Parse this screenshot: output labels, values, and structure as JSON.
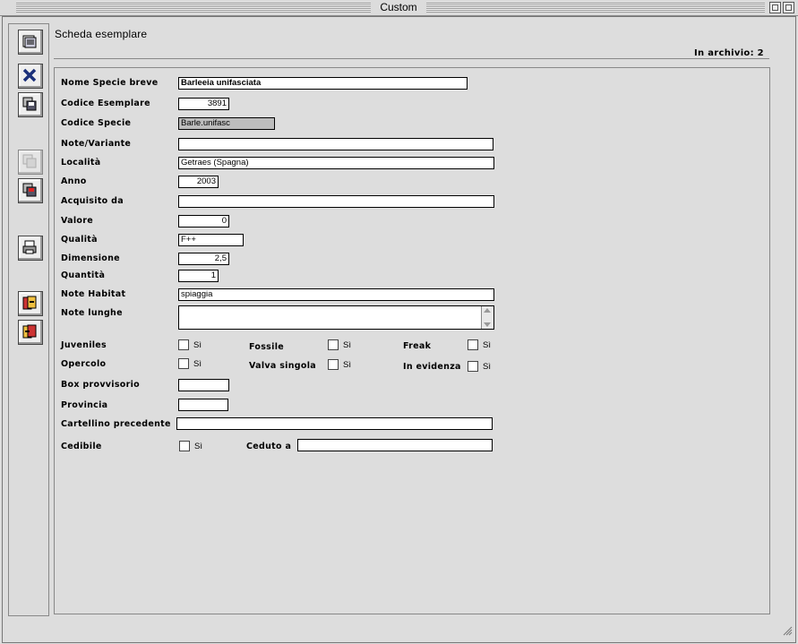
{
  "window": {
    "title": "Custom"
  },
  "header": {
    "sheet_title": "Scheda esemplare",
    "archive_count": "In archivio: 2"
  },
  "toolbar": {
    "buttons": [
      "form-view-icon",
      "delete-record-icon",
      "save-record-icon",
      "disabled-copy-icon",
      "save-copy-icon",
      "print-icon",
      "import-icon",
      "export-icon"
    ]
  },
  "form": {
    "nome_specie_breve": {
      "label": "Nome Specie breve",
      "value": "Barleeia unifasciata"
    },
    "codice_esemplare": {
      "label": "Codice Esemplare",
      "value": "3891"
    },
    "codice_specie": {
      "label": "Codice Specie",
      "value": "Barle.unifasc"
    },
    "note_variante": {
      "label": "Note/Variante",
      "value": ""
    },
    "localita": {
      "label": "Località",
      "value": "Getraes (Spagna)"
    },
    "anno": {
      "label": "Anno",
      "value": "2003"
    },
    "acquisito_da": {
      "label": "Acquisito da",
      "value": ""
    },
    "valore": {
      "label": "Valore",
      "value": "0"
    },
    "qualita": {
      "label": "Qualità",
      "value": "F++"
    },
    "dimensione": {
      "label": "Dimensione",
      "value": "2,5"
    },
    "quantita": {
      "label": "Quantità",
      "value": "1"
    },
    "note_habitat": {
      "label": "Note Habitat",
      "value": "spiaggia"
    },
    "note_lunghe": {
      "label": "Note lunghe",
      "value": ""
    },
    "juveniles": {
      "label": "Juveniles",
      "option": "Sì",
      "checked": false
    },
    "fossile": {
      "label": "Fossile",
      "option": "Sì",
      "checked": false
    },
    "freak": {
      "label": "Freak",
      "option": "Sì",
      "checked": false
    },
    "opercolo": {
      "label": "Opercolo",
      "option": "Sì",
      "checked": false
    },
    "valva_singola": {
      "label": "Valva singola",
      "option": "Sì",
      "checked": false
    },
    "in_evidenza": {
      "label": "In evidenza",
      "option": "Sì",
      "checked": false
    },
    "box_provvisorio": {
      "label": "Box provvisorio",
      "value": ""
    },
    "provincia": {
      "label": "Provincia",
      "value": ""
    },
    "cartellino_precedente": {
      "label": "Cartellino precedente",
      "value": ""
    },
    "cedibile": {
      "label": "Cedibile",
      "option": "Sì",
      "checked": false
    },
    "ceduto_a": {
      "label": "Ceduto a",
      "value": ""
    }
  }
}
